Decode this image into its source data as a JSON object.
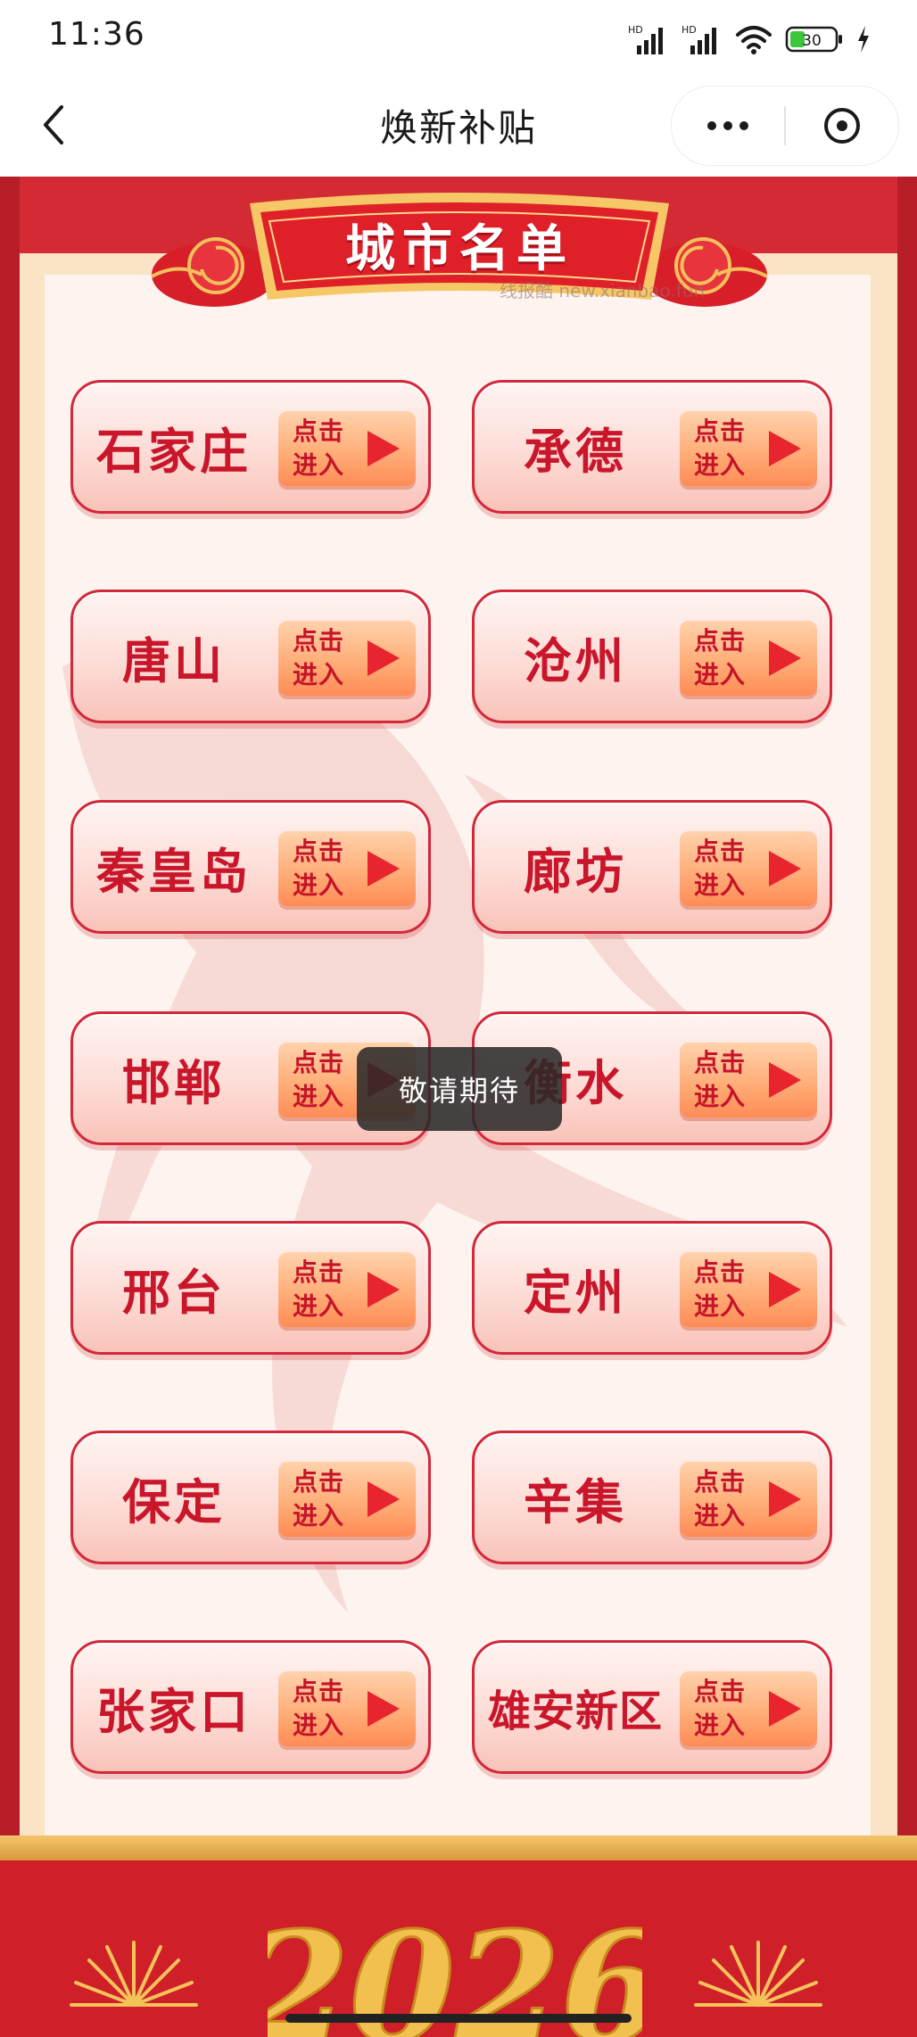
{
  "status_bar": {
    "time": "11:36",
    "battery_level": "30",
    "signal_label_1": "HD",
    "signal_label_2": "HD"
  },
  "nav": {
    "title": "焕新补贴",
    "back_icon": "chevron-left-icon",
    "more_icon": "more-horizontal-icon",
    "close_icon": "close-circle-icon"
  },
  "banner": {
    "title": "城市名单",
    "watermark": "线报酷 new.xianbao.fun",
    "year_text": "2026"
  },
  "enter_button": {
    "line1": "点击",
    "line2": "进入"
  },
  "cities": [
    {
      "name": "石家庄"
    },
    {
      "name": "承德"
    },
    {
      "name": "唐山"
    },
    {
      "name": "沧州"
    },
    {
      "name": "秦皇岛"
    },
    {
      "name": "廊坊"
    },
    {
      "name": "邯郸"
    },
    {
      "name": "衡水"
    },
    {
      "name": "邢台"
    },
    {
      "name": "定州"
    },
    {
      "name": "保定"
    },
    {
      "name": "辛集"
    },
    {
      "name": "张家口"
    },
    {
      "name": "雄安新区"
    }
  ],
  "toast": {
    "text": "敬请期待"
  },
  "colors": {
    "brand_red": "#d42a33",
    "card_text_red": "#c9162a",
    "paper": "#fdf4ef",
    "gold": "#f0b84a"
  }
}
